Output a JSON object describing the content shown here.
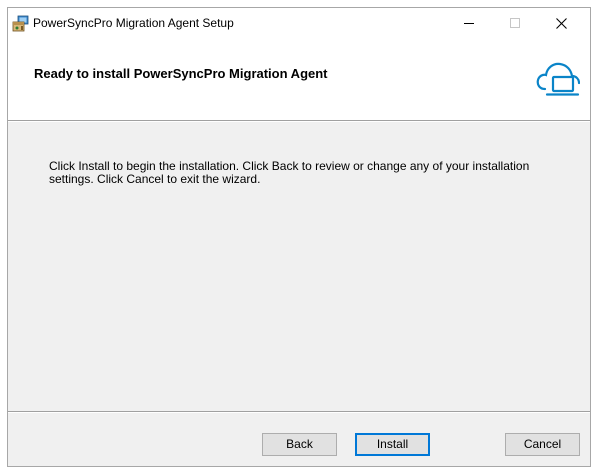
{
  "window": {
    "title": "PowerSyncPro Migration Agent Setup",
    "icon": "installer-icon"
  },
  "title_controls": {
    "minimize": "minimize-icon",
    "maximize": "maximize-icon",
    "close": "close-icon"
  },
  "banner": {
    "title": "Ready to install PowerSyncPro Migration Agent",
    "logo": "cloud-laptop-icon",
    "logo_color": "#0a84c8"
  },
  "body": {
    "text": "Click Install to begin the installation. Click Back to review or change any of your installation settings. Click Cancel to exit the wizard."
  },
  "buttons": {
    "back": "Back",
    "install": "Install",
    "cancel": "Cancel"
  },
  "colors": {
    "focus_border": "#0078d7",
    "dialog_bg": "#f0f0f0"
  }
}
